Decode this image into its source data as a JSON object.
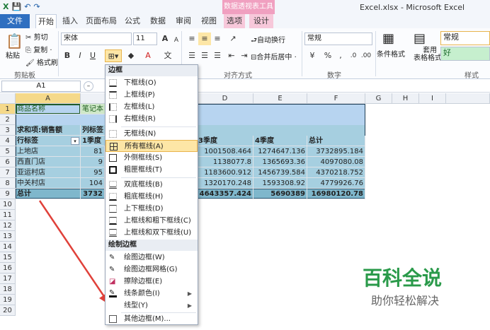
{
  "window": {
    "title": "Excel.xlsx - Microsoft Excel",
    "context_tab_title": "数据透视表工具"
  },
  "tabs": [
    {
      "label": "文件"
    },
    {
      "label": "开始"
    },
    {
      "label": "插入"
    },
    {
      "label": "页面布局"
    },
    {
      "label": "公式"
    },
    {
      "label": "数据"
    },
    {
      "label": "审阅"
    },
    {
      "label": "视图"
    },
    {
      "label": "选项"
    },
    {
      "label": "设计"
    }
  ],
  "ribbon": {
    "paste": "粘贴",
    "cut": "剪切",
    "copy": "复制 ·",
    "format_painter": "格式刷",
    "clipboard_label": "剪贴板",
    "font_name": "宋体",
    "font_size": "11",
    "wrap_text": "自动换行",
    "merge_center": "合并后居中 ·",
    "alignment_label": "对齐方式",
    "number_format": "常规",
    "number_label": "数字",
    "conditional_format": "条件格式",
    "table_format": "套用\n表格格式 ·",
    "style_normal": "常规",
    "style_good": "好",
    "styles_label": "样式"
  },
  "formula_bar": {
    "name_box": "A1"
  },
  "grid": {
    "columns": [
      "A",
      "B",
      "C",
      "D",
      "E",
      "F",
      "G",
      "H",
      "I"
    ],
    "rows": [
      [
        "商品名称",
        "笔记本",
        "",
        "",
        "",
        ""
      ],
      [
        "",
        "",
        "",
        "",
        "",
        ""
      ],
      [
        "求和项:销售额",
        "列标签",
        "",
        "",
        "",
        ""
      ],
      [
        "行标签",
        "1季度",
        "",
        "3季度",
        "4季度",
        "总计"
      ],
      [
        "上地店",
        "81",
        "",
        "1001508.464",
        "1274647.136",
        "3732895.184"
      ],
      [
        "西直门店",
        "9",
        "",
        "1138077.8",
        "1365693.36",
        "4097080.08"
      ],
      [
        "亚运村店",
        "95",
        "",
        "1183600.912",
        "1456739.584",
        "4370218.752"
      ],
      [
        "中关村店",
        "104",
        "",
        "1320170.248",
        "1593308.92",
        "4779926.76"
      ],
      [
        "总计",
        "3732",
        "",
        "4643357.424",
        "5690389",
        "16980120.78"
      ]
    ],
    "row_numbers": [
      "1",
      "2",
      "3",
      "4",
      "5",
      "6",
      "7",
      "8",
      "9",
      "10",
      "11",
      "12",
      "13",
      "14",
      "15",
      "16",
      "17",
      "18",
      "19",
      "20"
    ]
  },
  "menu": {
    "header_border": "边框",
    "header_draw": "绘制边框",
    "items": [
      {
        "label": "下框线(O)"
      },
      {
        "label": "上框线(P)"
      },
      {
        "label": "左框线(L)"
      },
      {
        "label": "右框线(R)"
      },
      {
        "label": "无框线(N)"
      },
      {
        "label": "所有框线(A)"
      },
      {
        "label": "外侧框线(S)"
      },
      {
        "label": "粗匣框线(T)"
      },
      {
        "label": "双底框线(B)"
      },
      {
        "label": "粗底框线(H)"
      },
      {
        "label": "上下框线(D)"
      },
      {
        "label": "上框线和粗下框线(C)"
      },
      {
        "label": "上框线和双下框线(U)"
      }
    ],
    "draw_items": [
      {
        "label": "绘图边框(W)"
      },
      {
        "label": "绘图边框网格(G)"
      },
      {
        "label": "擦除边框(E)"
      },
      {
        "label": "线条颜色(I)"
      },
      {
        "label": "线型(Y)"
      },
      {
        "label": "其他边框(M)..."
      }
    ]
  },
  "watermark": {
    "title": "百科全说",
    "subtitle": "助你轻松解决"
  },
  "colors": {
    "header_band": "#b7d4f0",
    "pivot_body": "#a6cfe0",
    "total_row": "#7fb7cc",
    "menu_highlight": "#fde6a6",
    "file_tab": "#2f6fc0",
    "annotation_arrow": "#e0413a"
  }
}
